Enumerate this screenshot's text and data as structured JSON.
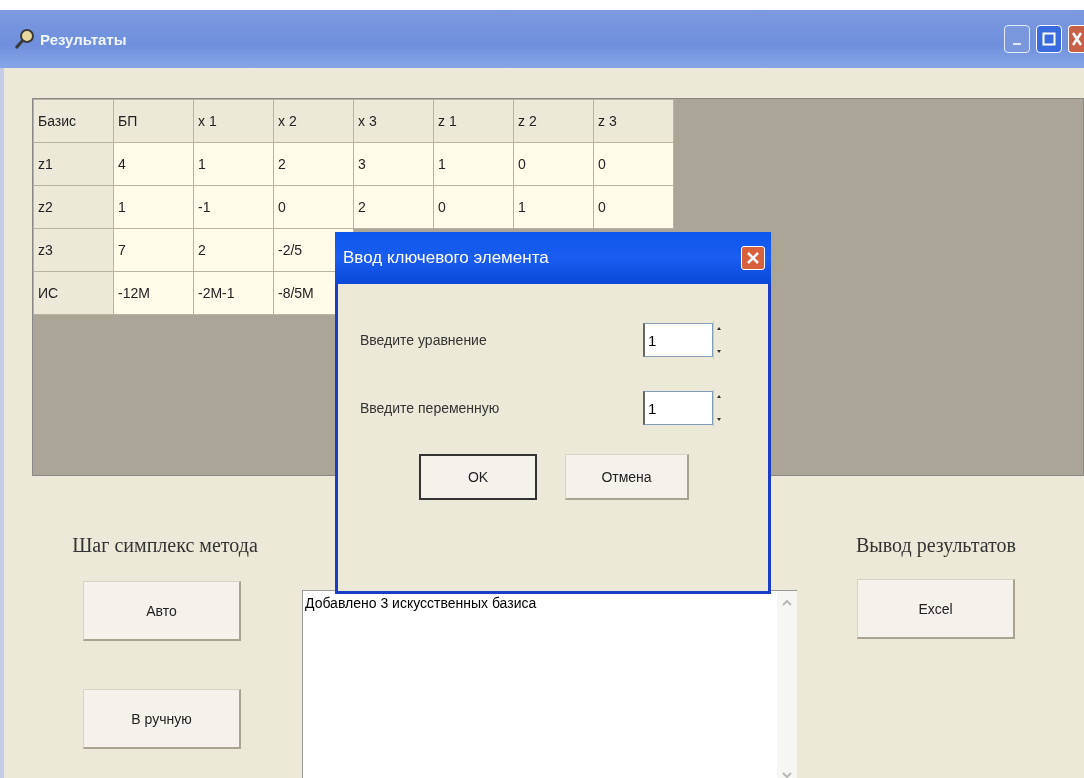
{
  "window": {
    "title": "Результаты"
  },
  "table": {
    "columns": [
      "Базис",
      "БП",
      "x 1",
      "x 2",
      "x 3",
      "z 1",
      "z 2",
      "z 3"
    ],
    "rows": [
      [
        "z1",
        "4",
        "1",
        "2",
        "3",
        "1",
        "0",
        "0"
      ],
      [
        "z2",
        "1",
        "-1",
        "0",
        "2",
        "0",
        "1",
        "0"
      ],
      [
        "z3",
        "7",
        "2",
        "-2/5"
      ],
      [
        "ИС",
        "-12M",
        "-2M-1",
        "-8/5M"
      ]
    ]
  },
  "step_section": {
    "title": "Шаг симплекс метода",
    "buttons": [
      "Авто",
      "В ручную"
    ]
  },
  "log": {
    "lines": [
      "Добавлено 3 искусственных базиса"
    ]
  },
  "output_section": {
    "title": "Вывод результатов",
    "buttons": [
      "Excel"
    ]
  },
  "dialog": {
    "title": "Ввод ключевого элемента",
    "fields": [
      {
        "label": "Введите уравнение",
        "value": "1"
      },
      {
        "label": "Введите переменную",
        "value": "1"
      }
    ],
    "buttons": [
      {
        "label": "OK",
        "selected": true
      },
      {
        "label": "Отмена",
        "selected": false
      }
    ]
  }
}
